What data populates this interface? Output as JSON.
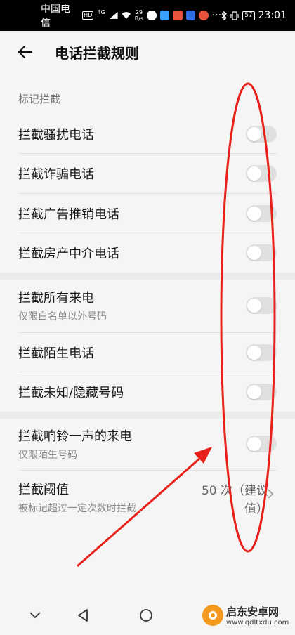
{
  "status_bar": {
    "carrier": "中国电信",
    "hd": "HD",
    "network": "4G",
    "speed_value": "29",
    "speed_unit": "B/s",
    "more": "···",
    "battery": "57",
    "time": "23:01"
  },
  "header": {
    "title": "电话拦截规则"
  },
  "sections": {
    "marked_label": "标记拦截"
  },
  "rows": {
    "harass": {
      "title": "拦截骚扰电话",
      "enabled": false
    },
    "fraud": {
      "title": "拦截诈骗电话",
      "enabled": false
    },
    "ads": {
      "title": "拦截广告推销电话",
      "enabled": false
    },
    "agent": {
      "title": "拦截房产中介电话",
      "enabled": false
    },
    "all_calls": {
      "title": "拦截所有来电",
      "subtitle": "仅限白名单以外号码",
      "enabled": false
    },
    "stranger": {
      "title": "拦截陌生电话",
      "enabled": false
    },
    "unknown": {
      "title": "拦截未知/隐藏号码",
      "enabled": false
    },
    "one_ring": {
      "title": "拦截响铃一声的来电",
      "subtitle": "仅限陌生号码",
      "enabled": false
    },
    "threshold": {
      "title": "拦截阈值",
      "subtitle": "被标记超过一定次数时拦截",
      "value_line1": "50 次（建议",
      "value_line2": "值）"
    }
  },
  "watermark": {
    "name": "启东安卓网",
    "url": "www.qdltxdu.com"
  },
  "colors": {
    "annotation_red": "#e8201a",
    "toggle_off": "#e0e0e0"
  }
}
